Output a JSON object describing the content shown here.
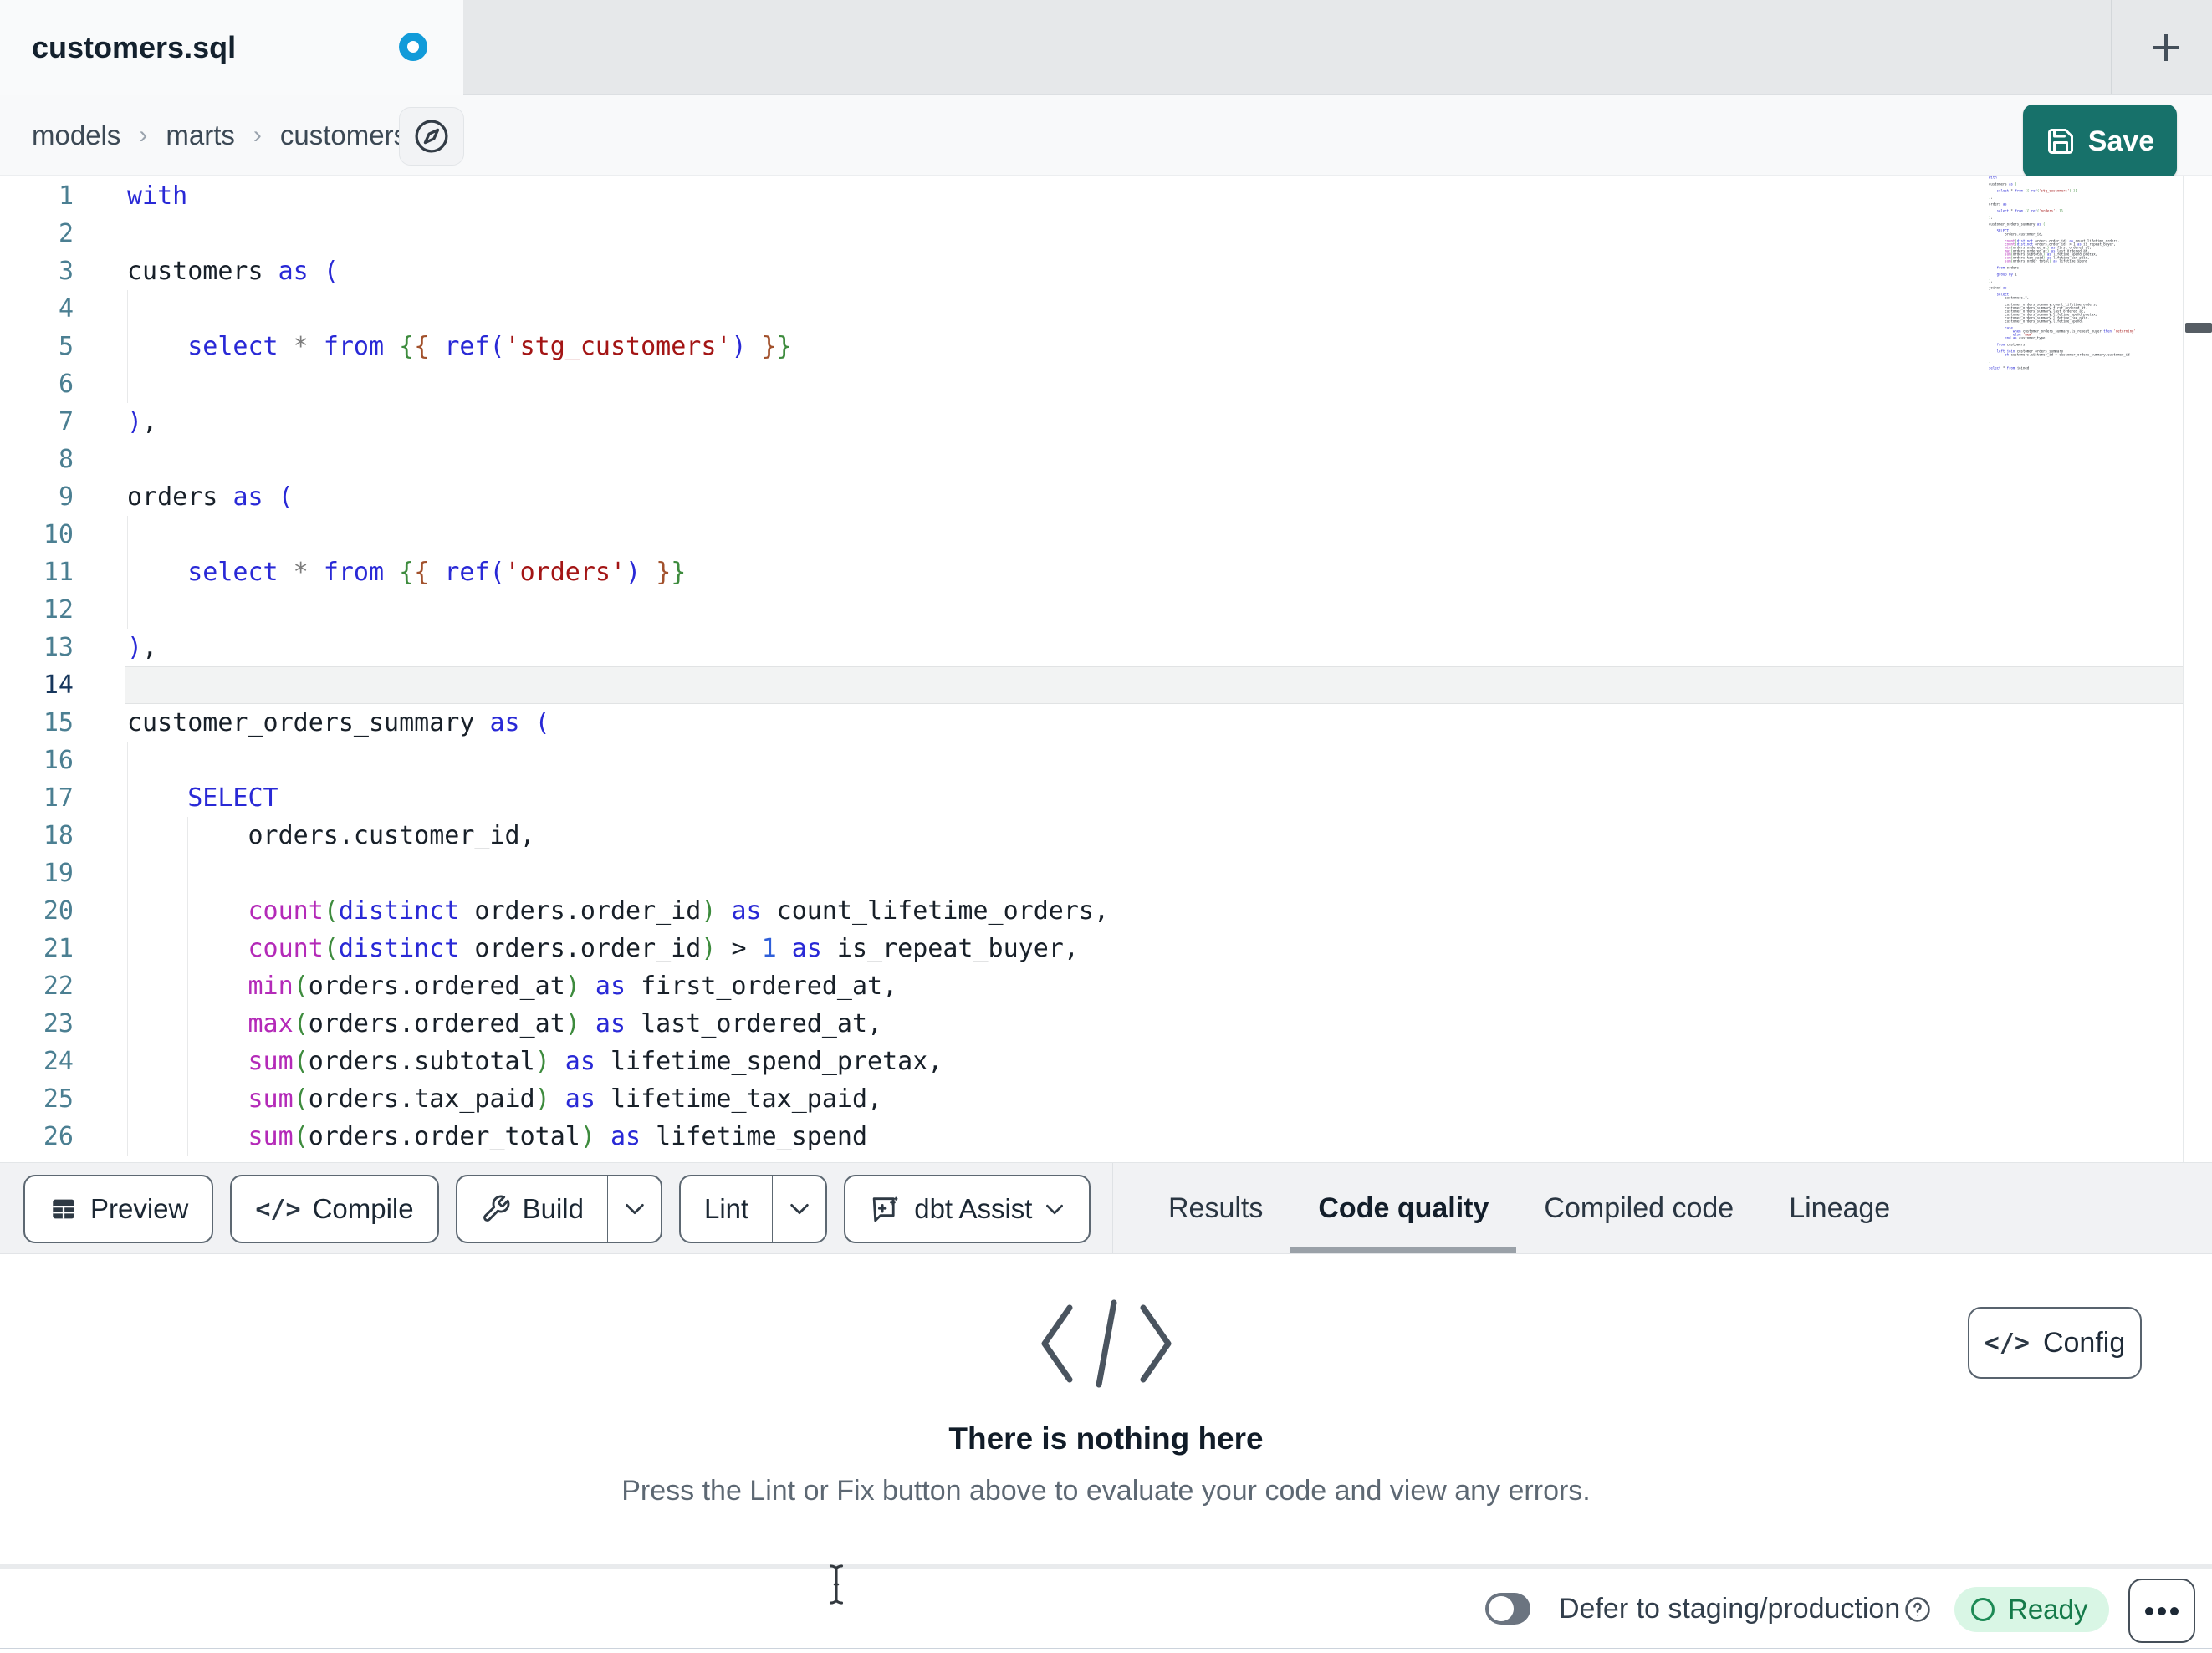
{
  "tab_bar": {
    "tab_title": "customers.sql",
    "unsaved_indicator": "blue-dot"
  },
  "breadcrumb": {
    "items": [
      "models",
      "marts",
      "customers.sql"
    ],
    "separator": "›"
  },
  "save": {
    "label": "Save"
  },
  "toolbar": {
    "preview_label": "Preview",
    "compile_label": "Compile",
    "build_label": "Build",
    "lint_label": "Lint",
    "assist_label": "dbt Assist"
  },
  "panel_tabs": [
    {
      "label": "Results",
      "active": false
    },
    {
      "label": "Code quality",
      "active": true
    },
    {
      "label": "Compiled code",
      "active": false
    },
    {
      "label": "Lineage",
      "active": false
    }
  ],
  "empty_state": {
    "title": "There is nothing here",
    "description": "Press the Lint or Fix button above to evaluate your code and view any errors.",
    "config_label": "Config",
    "config_glyph": "</>"
  },
  "status_bar": {
    "defer_label": "Defer to staging/production",
    "ready_label": "Ready"
  },
  "compile_glyph": "</>",
  "editor": {
    "active_line": 14,
    "lines": [
      {
        "n": 1,
        "g": 0,
        "i": 0,
        "t": [
          [
            "kw",
            "with"
          ]
        ]
      },
      {
        "n": 2,
        "g": 0,
        "i": 0,
        "t": []
      },
      {
        "n": 3,
        "g": 0,
        "i": 0,
        "t": [
          [
            "pl",
            "customers "
          ],
          [
            "kw",
            "as"
          ],
          [
            "pl",
            " "
          ],
          [
            "pn",
            "("
          ]
        ]
      },
      {
        "n": 4,
        "g": 1,
        "i": 0,
        "t": []
      },
      {
        "n": 5,
        "g": 1,
        "i": 4,
        "t": [
          [
            "kw",
            "select"
          ],
          [
            "op",
            " * "
          ],
          [
            "kw",
            "from"
          ],
          [
            "pl",
            " "
          ],
          [
            "jg",
            "{"
          ],
          [
            "jb",
            "{"
          ],
          [
            "pl",
            " "
          ],
          [
            "kw",
            "ref"
          ],
          [
            "pn",
            "("
          ],
          [
            "str",
            "'stg_customers'"
          ],
          [
            "pn",
            ")"
          ],
          [
            "pl",
            " "
          ],
          [
            "jb",
            "}"
          ],
          [
            "jg",
            "}"
          ]
        ]
      },
      {
        "n": 6,
        "g": 1,
        "i": 0,
        "t": []
      },
      {
        "n": 7,
        "g": 0,
        "i": 0,
        "t": [
          [
            "pn",
            ")"
          ],
          [
            "pl",
            ","
          ]
        ]
      },
      {
        "n": 8,
        "g": 0,
        "i": 0,
        "t": []
      },
      {
        "n": 9,
        "g": 0,
        "i": 0,
        "t": [
          [
            "pl",
            "orders "
          ],
          [
            "kw",
            "as"
          ],
          [
            "pl",
            " "
          ],
          [
            "pn",
            "("
          ]
        ]
      },
      {
        "n": 10,
        "g": 1,
        "i": 0,
        "t": []
      },
      {
        "n": 11,
        "g": 1,
        "i": 4,
        "t": [
          [
            "kw",
            "select"
          ],
          [
            "op",
            " * "
          ],
          [
            "kw",
            "from"
          ],
          [
            "pl",
            " "
          ],
          [
            "jg",
            "{"
          ],
          [
            "jb",
            "{"
          ],
          [
            "pl",
            " "
          ],
          [
            "kw",
            "ref"
          ],
          [
            "pn",
            "("
          ],
          [
            "str",
            "'orders'"
          ],
          [
            "pn",
            ")"
          ],
          [
            "pl",
            " "
          ],
          [
            "jb",
            "}"
          ],
          [
            "jg",
            "}"
          ]
        ]
      },
      {
        "n": 12,
        "g": 1,
        "i": 0,
        "t": []
      },
      {
        "n": 13,
        "g": 0,
        "i": 0,
        "t": [
          [
            "pn",
            ")"
          ],
          [
            "pl",
            ","
          ]
        ]
      },
      {
        "n": 14,
        "g": 0,
        "i": 0,
        "t": [],
        "active": true
      },
      {
        "n": 15,
        "g": 0,
        "i": 0,
        "t": [
          [
            "pl",
            "customer_orders_summary "
          ],
          [
            "kw",
            "as"
          ],
          [
            "pl",
            " "
          ],
          [
            "pn",
            "("
          ]
        ]
      },
      {
        "n": 16,
        "g": 1,
        "i": 0,
        "t": []
      },
      {
        "n": 17,
        "g": 1,
        "i": 4,
        "t": [
          [
            "kw",
            "SELECT"
          ]
        ]
      },
      {
        "n": 18,
        "g": 2,
        "i": 8,
        "t": [
          [
            "pl",
            "orders.customer_id,"
          ]
        ]
      },
      {
        "n": 19,
        "g": 2,
        "i": 0,
        "t": []
      },
      {
        "n": 20,
        "g": 2,
        "i": 8,
        "t": [
          [
            "fn",
            "count"
          ],
          [
            "br",
            "("
          ],
          [
            "kw",
            "distinct"
          ],
          [
            "pl",
            " orders.order_id"
          ],
          [
            "br",
            ")"
          ],
          [
            "kw",
            " as"
          ],
          [
            "pl",
            " count_lifetime_orders,"
          ]
        ]
      },
      {
        "n": 21,
        "g": 2,
        "i": 8,
        "t": [
          [
            "fn",
            "count"
          ],
          [
            "br",
            "("
          ],
          [
            "kw",
            "distinct"
          ],
          [
            "pl",
            " orders.order_id"
          ],
          [
            "br",
            ")"
          ],
          [
            "pl",
            " > "
          ],
          [
            "num",
            "1"
          ],
          [
            "kw",
            " as"
          ],
          [
            "pl",
            " is_repeat_buyer,"
          ]
        ]
      },
      {
        "n": 22,
        "g": 2,
        "i": 8,
        "t": [
          [
            "fn",
            "min"
          ],
          [
            "br",
            "("
          ],
          [
            "pl",
            "orders.ordered_at"
          ],
          [
            "br",
            ")"
          ],
          [
            "kw",
            " as"
          ],
          [
            "pl",
            " first_ordered_at,"
          ]
        ]
      },
      {
        "n": 23,
        "g": 2,
        "i": 8,
        "t": [
          [
            "fn",
            "max"
          ],
          [
            "br",
            "("
          ],
          [
            "pl",
            "orders.ordered_at"
          ],
          [
            "br",
            ")"
          ],
          [
            "kw",
            " as"
          ],
          [
            "pl",
            " last_ordered_at,"
          ]
        ]
      },
      {
        "n": 24,
        "g": 2,
        "i": 8,
        "t": [
          [
            "fn",
            "sum"
          ],
          [
            "br",
            "("
          ],
          [
            "pl",
            "orders.subtotal"
          ],
          [
            "br",
            ")"
          ],
          [
            "kw",
            " as"
          ],
          [
            "pl",
            " lifetime_spend_pretax,"
          ]
        ]
      },
      {
        "n": 25,
        "g": 2,
        "i": 8,
        "t": [
          [
            "fn",
            "sum"
          ],
          [
            "br",
            "("
          ],
          [
            "pl",
            "orders.tax_paid"
          ],
          [
            "br",
            ")"
          ],
          [
            "kw",
            " as"
          ],
          [
            "pl",
            " lifetime_tax_paid,"
          ]
        ]
      },
      {
        "n": 26,
        "g": 2,
        "i": 8,
        "t": [
          [
            "fn",
            "sum"
          ],
          [
            "br",
            "("
          ],
          [
            "pl",
            "orders.order_total"
          ],
          [
            "br",
            ")"
          ],
          [
            "kw",
            " as"
          ],
          [
            "pl",
            " lifetime_spend"
          ]
        ]
      }
    ]
  },
  "minimap_lines": [
    "with",
    "",
    "customers as (",
    "",
    "    select * from {{ ref('stg_customers') }}",
    "",
    "),",
    "",
    "orders as (",
    "",
    "    select * from {{ ref('orders') }}",
    "",
    "),",
    "",
    "customer_orders_summary as (",
    "",
    "    SELECT",
    "        orders.customer_id,",
    "",
    "        count(distinct orders.order_id) as count_lifetime_orders,",
    "        count(distinct orders.order_id) > 1 as is_repeat_buyer,",
    "        min(orders.ordered_at) as first_ordered_at,",
    "        max(orders.ordered_at) as last_ordered_at,",
    "        sum(orders.subtotal) as lifetime_spend_pretax,",
    "        sum(orders.tax_paid) as lifetime_tax_paid,",
    "        sum(orders.order_total) as lifetime_spend",
    "",
    "    from orders",
    "",
    "    group by 1",
    "",
    "),",
    "",
    "joined as (",
    "",
    "    select",
    "        customers.*,",
    "",
    "        customer_orders_summary.count_lifetime_orders,",
    "        customer_orders_summary.first_ordered_at,",
    "        customer_orders_summary.last_ordered_at,",
    "        customer_orders_summary.lifetime_spend_pretax,",
    "        customer_orders_summary.lifetime_tax_paid,",
    "        customer_orders_summary.lifetime_spend,",
    "",
    "        case",
    "            when customer_orders_summary.is_repeat_buyer then 'returning'",
    "            else 'new'",
    "        end as customer_type",
    "",
    "    from customers",
    "",
    "    left join customer_orders_summary",
    "        on customers.customer_id = customer_orders_summary.customer_id",
    "",
    ")",
    "",
    "select * from joined"
  ],
  "icons": {
    "save": "floppy-disk",
    "breadcrumb_action": "compass",
    "new_tab": "plus",
    "preview": "table-grid",
    "compile": "code-brackets",
    "build": "wrench",
    "assist": "chat-sparkle",
    "dropdown": "chevron-down",
    "empty": "code-brackets",
    "config": "code-brackets",
    "help": "question-circle",
    "more": "ellipsis",
    "ready": "circle-outline",
    "pointer": "text-ibeam"
  },
  "colors": {
    "save_teal": "#17716a",
    "unsaved_dot_blue": "#129bd9",
    "tab_strip_gray": "#e6e8ea",
    "ready_bg": "#d9f6e5",
    "ready_fg": "#157a4a",
    "tab_underline": "#9aa1a8",
    "line_number": "#4b7f92",
    "keyword_blue": "#2929d6",
    "function_magenta": "#b42ab8",
    "string_red": "#a31515",
    "jinja_green": "#3d8b3d"
  }
}
